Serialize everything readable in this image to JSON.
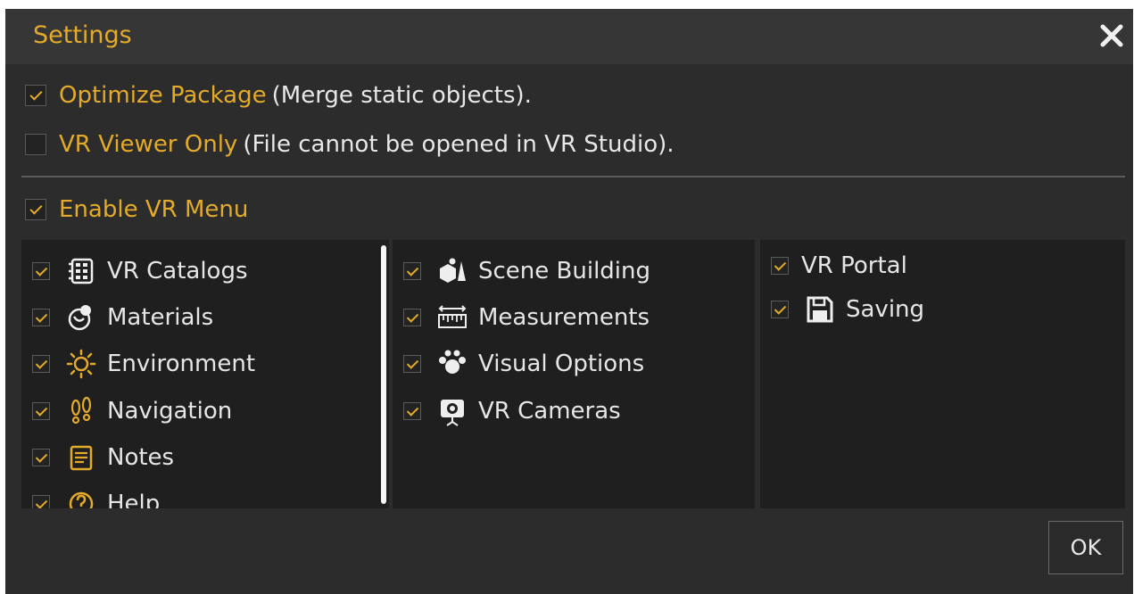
{
  "dialog": {
    "title": "Settings",
    "close_icon": "close-icon"
  },
  "options": {
    "optimize": {
      "label": "Optimize Package",
      "note": "(Merge static objects).",
      "checked": true
    },
    "viewer_only": {
      "label": "VR Viewer Only",
      "note": "(File cannot be opened in VR Studio).",
      "checked": false
    },
    "enable_menu": {
      "label": "Enable VR Menu",
      "checked": true
    }
  },
  "menu_columns": [
    [
      {
        "label": "VR Catalogs",
        "icon": "catalog-grid-icon",
        "checked": true
      },
      {
        "label": "Materials",
        "icon": "materials-sphere-icon",
        "checked": true
      },
      {
        "label": "Environment",
        "icon": "sun-icon",
        "checked": true
      },
      {
        "label": "Navigation",
        "icon": "footprints-icon",
        "checked": true
      },
      {
        "label": "Notes",
        "icon": "notes-icon",
        "checked": true
      },
      {
        "label": "Help",
        "icon": "help-icon",
        "checked": true
      }
    ],
    [
      {
        "label": "Scene Building",
        "icon": "shapes-icon",
        "checked": true
      },
      {
        "label": "Measurements",
        "icon": "ruler-icon",
        "checked": true
      },
      {
        "label": "Visual Options",
        "icon": "visual-options-icon",
        "checked": true
      },
      {
        "label": "VR Cameras",
        "icon": "camera-icon",
        "checked": true
      }
    ],
    [
      {
        "label": "VR Portal",
        "icon": "",
        "checked": true
      },
      {
        "label": "Saving",
        "icon": "save-icon",
        "checked": true
      }
    ]
  ],
  "buttons": {
    "ok": "OK"
  },
  "colors": {
    "accent": "#e4aa2a",
    "dialog_bg": "#2c2c2c",
    "panel_bg": "#1f1f1f",
    "titlebar_bg": "#363636"
  }
}
